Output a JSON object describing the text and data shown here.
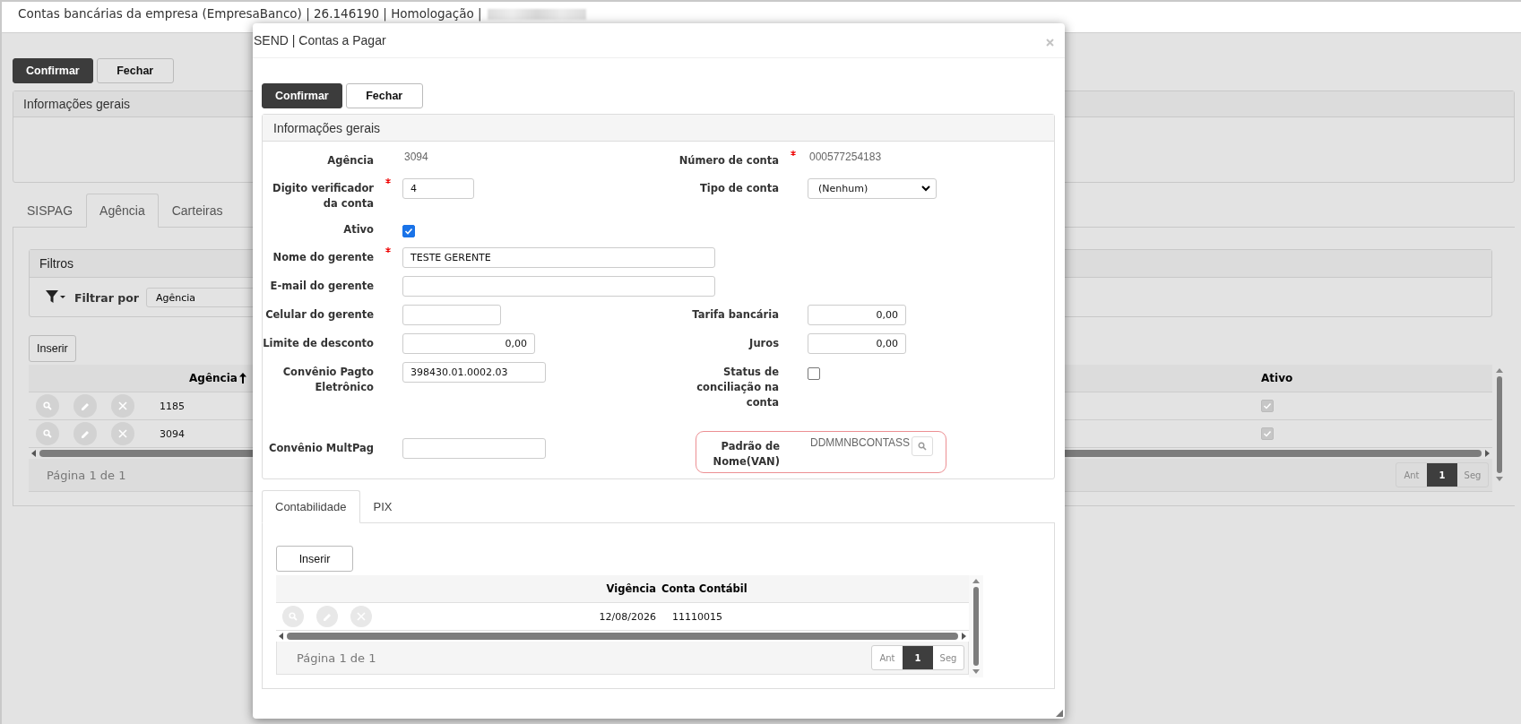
{
  "page": {
    "title": "Contas bancárias da empresa (EmpresaBanco) | 26.146190 | Homologação |"
  },
  "background": {
    "buttons": [
      {
        "label": "Confirmar",
        "primary": true
      },
      {
        "label": "Fechar",
        "primary": false
      }
    ],
    "panel_title": "Informações gerais",
    "tabs": [
      {
        "label": "SISPAG",
        "selected": false
      },
      {
        "label": "Agência",
        "selected": true
      },
      {
        "label": "Carteiras",
        "selected": false
      }
    ],
    "filters": {
      "title": "Filtros",
      "label": "Filtrar por",
      "value": "Agência"
    },
    "insert_button": "Inserir",
    "table": {
      "columns": [
        {
          "label": "Agência",
          "sorted_ascending": true
        },
        {
          "label": "Ativo"
        }
      ],
      "rows": [
        {
          "agencia": "1185",
          "ativo": true
        },
        {
          "agencia": "3094",
          "ativo": true
        }
      ]
    },
    "pager": {
      "summary": "Página 1 de 1",
      "prev": "Ant",
      "pages": [
        {
          "label": "1",
          "selected": true
        }
      ],
      "next": "Seg"
    }
  },
  "dialog": {
    "title": "SEND | Contas a Pagar",
    "buttons": [
      {
        "label": "Confirmar",
        "primary": true
      },
      {
        "label": "Fechar",
        "primary": false
      }
    ],
    "panel_title": "Informações gerais",
    "rows": [
      {
        "left": {
          "label": "Agência",
          "kind": "static",
          "value": "3094",
          "required": false,
          "highlighted": false
        },
        "right": {
          "label": "Número de conta",
          "kind": "static",
          "value": "000577254183",
          "required": true,
          "highlighted": false
        }
      },
      {
        "left": {
          "label": "Digito verificador da conta",
          "kind": "input",
          "value": "4",
          "required": true,
          "highlighted": false
        },
        "right": {
          "label": "Tipo de conta",
          "kind": "select",
          "value": "(Nenhum)",
          "required": false,
          "highlighted": false
        }
      },
      {
        "left": {
          "label": "Ativo",
          "kind": "checkbox",
          "checked": true,
          "required": false,
          "highlighted": false
        }
      },
      {
        "left": {
          "label": "Nome do gerente",
          "kind": "input",
          "value": "TESTE GERENTE",
          "required": true,
          "highlighted": false
        }
      },
      {
        "left": {
          "label": "E-mail do gerente",
          "kind": "input",
          "required": false,
          "highlighted": false
        }
      },
      {
        "left": {
          "label": "Celular do gerente",
          "kind": "input",
          "required": false,
          "highlighted": false
        },
        "right": {
          "label": "Tarifa bancária",
          "kind": "amount",
          "value": "0,00",
          "required": false,
          "highlighted": false
        }
      },
      {
        "left": {
          "label": "Limite de desconto",
          "kind": "amount",
          "value": "0,00",
          "required": false,
          "highlighted": false
        },
        "right": {
          "label": "Juros",
          "kind": "amount",
          "value": "0,00",
          "required": false,
          "highlighted": false
        }
      },
      {
        "left": {
          "label": "Convênio Pagto Eletrônico",
          "kind": "input",
          "value": "398430.01.0002.03",
          "required": false,
          "highlighted": false
        },
        "right": {
          "label": "Status de conciliação na conta",
          "kind": "checkbox",
          "checked": false,
          "required": false,
          "highlighted": false
        }
      },
      {
        "left": {
          "label": "Convênio MultPag",
          "kind": "input",
          "required": false,
          "highlighted": false
        },
        "right": {
          "label": "Padrão de Nome(VAN)",
          "kind": "lookup",
          "value": "DDMMNBCONTASS",
          "required": false,
          "highlighted": true
        }
      }
    ],
    "tabs": [
      {
        "label": "Contabilidade",
        "selected": true
      },
      {
        "label": "PIX",
        "selected": false
      }
    ],
    "insert_button": "Inserir",
    "table": {
      "columns": [
        "Vigência",
        "Conta Contábil"
      ],
      "rows": [
        {
          "cells": [
            "12/08/2026",
            "11110015"
          ]
        }
      ]
    },
    "pager": {
      "summary": "Página 1 de 1",
      "prev": "Ant",
      "pages": [
        {
          "label": "1",
          "selected": true
        }
      ],
      "next": "Seg"
    }
  }
}
